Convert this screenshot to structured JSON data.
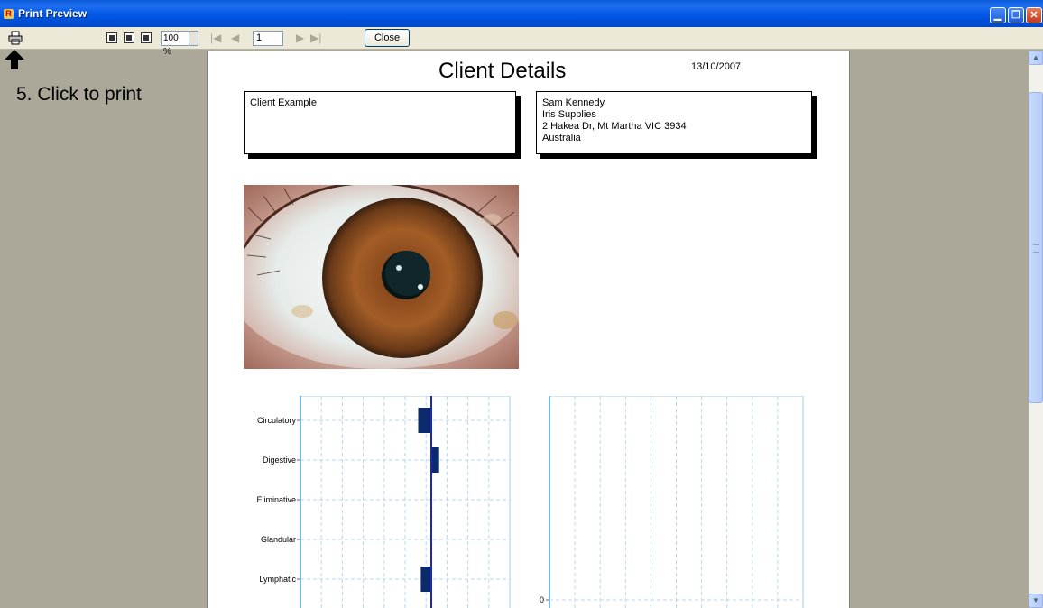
{
  "window": {
    "title": "Print Preview",
    "app_icon_letter": "R",
    "minimize_glyph": "▁",
    "maximize_glyph": "❐",
    "close_glyph": "✕"
  },
  "toolbar": {
    "zoom_value": "100 %",
    "first_glyph": "|◀",
    "prev_glyph": "◀",
    "page_number": "1",
    "next_glyph": "▶",
    "last_glyph": "▶|",
    "close_label": "Close"
  },
  "annotation": {
    "text": "5. Click to print"
  },
  "report": {
    "title": "Client Details",
    "date": "13/10/2007",
    "client_box": {
      "name": "Client Example"
    },
    "supplier_box": {
      "lines": [
        "Sam Kennedy",
        "Iris Supplies",
        "2 Hakea Dr, Mt Martha VIC 3934",
        "Australia"
      ]
    }
  },
  "chart_data": [
    {
      "type": "bar",
      "orientation": "horizontal",
      "categories": [
        "Circulatory",
        "Digestive",
        "Eliminative",
        "Glandular",
        "Lymphatic"
      ],
      "values": [
        -1,
        0.6,
        0,
        0,
        -0.8
      ],
      "xlim": [
        -10,
        6
      ],
      "zero_line": true,
      "grid": true,
      "color": "#0b2a6b"
    },
    {
      "type": "bar",
      "orientation": "horizontal",
      "categories": [],
      "values": [],
      "ytick_labels": [
        "0"
      ],
      "grid": true
    }
  ],
  "colors": {
    "bar": "#0b2a6b",
    "zero_line": "#1c28b8",
    "grid": "#b6d9f0",
    "axis": "#9fd2ec"
  }
}
